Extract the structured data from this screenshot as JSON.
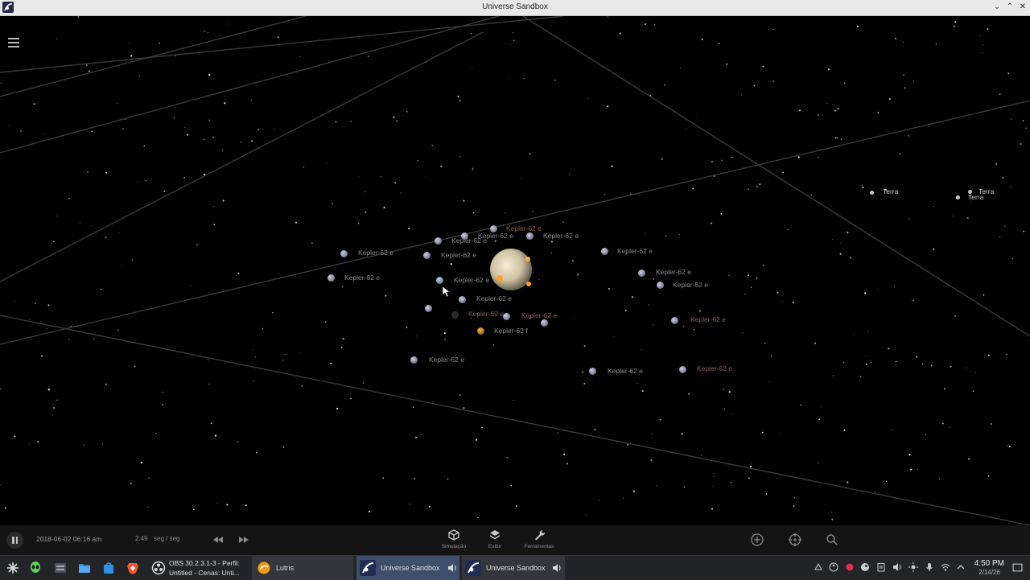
{
  "window": {
    "title": "Universe Sandbox"
  },
  "space": {
    "central_star": {
      "name": "Kepler-62",
      "color": "#d8c9a6"
    },
    "labels": [
      {
        "text": "Kepler-62 e",
        "style": "dim"
      },
      {
        "text": "Kepler-62 e",
        "style": "dim"
      },
      {
        "text": "Kepler-62 e",
        "style": "dim"
      },
      {
        "text": "Kepler-62 e",
        "style": "dim"
      },
      {
        "text": "Kepler-62 e",
        "style": "dim"
      },
      {
        "text": "Kepler-62 e",
        "style": "red"
      },
      {
        "text": "Kepler-62 e",
        "style": "dim"
      },
      {
        "text": "Kepler-62 e",
        "style": "dim"
      },
      {
        "text": "Kepler-62 e",
        "style": "dim"
      },
      {
        "text": "Kepler-62 e",
        "style": "dim"
      },
      {
        "text": "Kepler-62 e",
        "style": "dim"
      },
      {
        "text": "Kepler-62 e",
        "style": "dim"
      },
      {
        "text": "Kepler-69 e",
        "style": "red"
      },
      {
        "text": "Kepler-62 e",
        "style": "red"
      },
      {
        "text": "Kepler-62 f",
        "style": "dim"
      },
      {
        "text": "Kepler-62 e",
        "style": "red"
      },
      {
        "text": "Kepler-62 e",
        "style": "dim"
      },
      {
        "text": "Kepler-62 e",
        "style": "dim"
      },
      {
        "text": "Kepler-62 e",
        "style": "red"
      },
      {
        "text": "Terra",
        "style": "bright"
      },
      {
        "text": "Terra",
        "style": "bright"
      },
      {
        "text": "Terra",
        "style": "bright"
      }
    ]
  },
  "controls": {
    "date": "2018-06-02 06:16 am",
    "time_rate": "2.49",
    "time_unit": "seg / seg",
    "tools": [
      {
        "label": "Simulação",
        "icon": "cube-icon"
      },
      {
        "label": "Exibir",
        "icon": "layers-icon"
      },
      {
        "label": "Ferramentas",
        "icon": "wrench-icon"
      }
    ]
  },
  "taskbar": {
    "tasks": {
      "obs_line1": "OBS 30.2.3.1-3 - Perfil:",
      "obs_line2": "Untitled - Cenas: Unti...",
      "lutris": "Lutris",
      "universe1": "Universe Sandbox",
      "universe2": "Universe Sandbox"
    },
    "clock": {
      "time": "4:50 PM",
      "date": "2/14/26"
    }
  }
}
